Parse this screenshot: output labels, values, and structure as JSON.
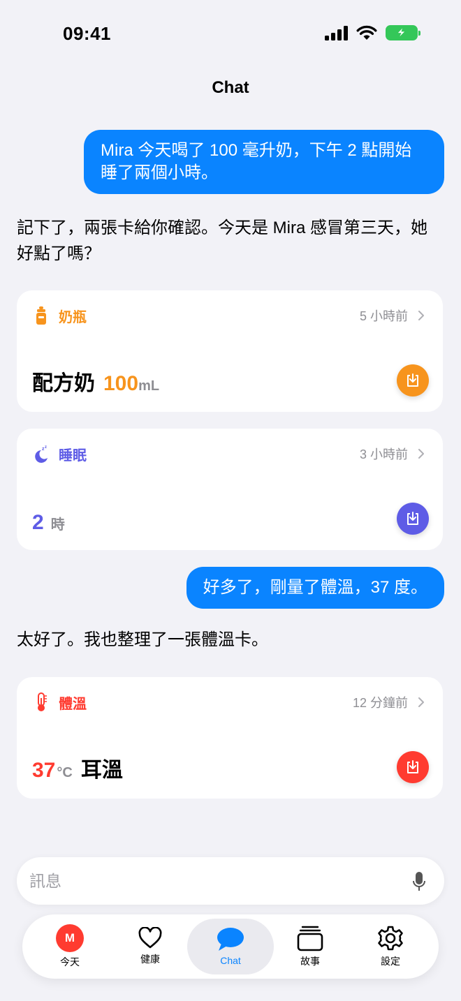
{
  "status": {
    "time": "09:41"
  },
  "nav": {
    "title": "Chat"
  },
  "messages": {
    "user1": "Mira 今天喝了 100 毫升奶，下午 2 點開始睡了兩個小時。",
    "assistant1": "記下了，兩張卡給你確認。今天是 Mira 感冒第三天，她好點了嗎？",
    "user2": "好多了，剛量了體溫，37 度。",
    "assistant2": "太好了。我也整理了一張體溫卡。"
  },
  "cards": {
    "bottle": {
      "title": "奶瓶",
      "time": "5 小時前",
      "label": "配方奶",
      "value": "100",
      "unit": "mL",
      "color": "#f7941d"
    },
    "sleep": {
      "title": "睡眠",
      "time": "3 小時前",
      "value": "2",
      "unit": "時",
      "color": "#5e5ce6"
    },
    "temp": {
      "title": "體溫",
      "time": "12 分鐘前",
      "value": "37",
      "unit": "°C",
      "label": "耳溫",
      "color": "#ff3b30"
    }
  },
  "input": {
    "placeholder": "訊息"
  },
  "tabs": {
    "today": {
      "label": "今天",
      "avatar": "M"
    },
    "health": {
      "label": "健康"
    },
    "chat": {
      "label": "Chat"
    },
    "stories": {
      "label": "故事"
    },
    "settings": {
      "label": "設定"
    }
  }
}
